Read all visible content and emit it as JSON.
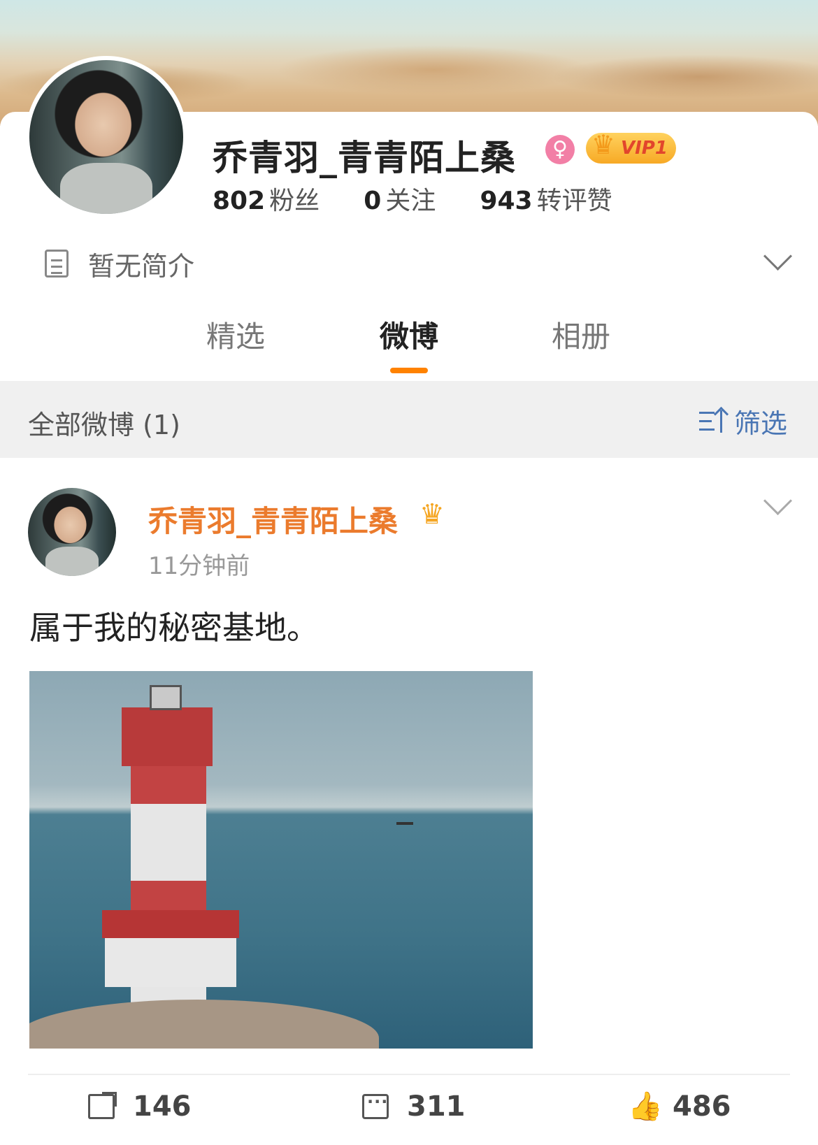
{
  "profile": {
    "name": "乔青羽_青青陌上桑",
    "gender_icon": "female-icon",
    "vip_label": "VIP1",
    "stats": [
      {
        "value": "802",
        "label": "粉丝"
      },
      {
        "value": "0",
        "label": "关注"
      },
      {
        "value": "943",
        "label": "转评赞"
      }
    ],
    "intro": "暂无简介"
  },
  "tabs": [
    {
      "label": "精选",
      "active": false
    },
    {
      "label": "微博",
      "active": true
    },
    {
      "label": "相册",
      "active": false
    }
  ],
  "filter": {
    "title": "全部微博 (1)",
    "button_label": "筛选"
  },
  "post": {
    "author": "乔青羽_青青陌上桑",
    "time": "11分钟前",
    "text": "属于我的秘密基地。",
    "image_alt": "lighthouse",
    "reposts": "146",
    "comments": "311",
    "likes": "486"
  },
  "colors": {
    "accent": "#ff8200",
    "username": "#eb7b2d",
    "link": "#4a76b4"
  }
}
